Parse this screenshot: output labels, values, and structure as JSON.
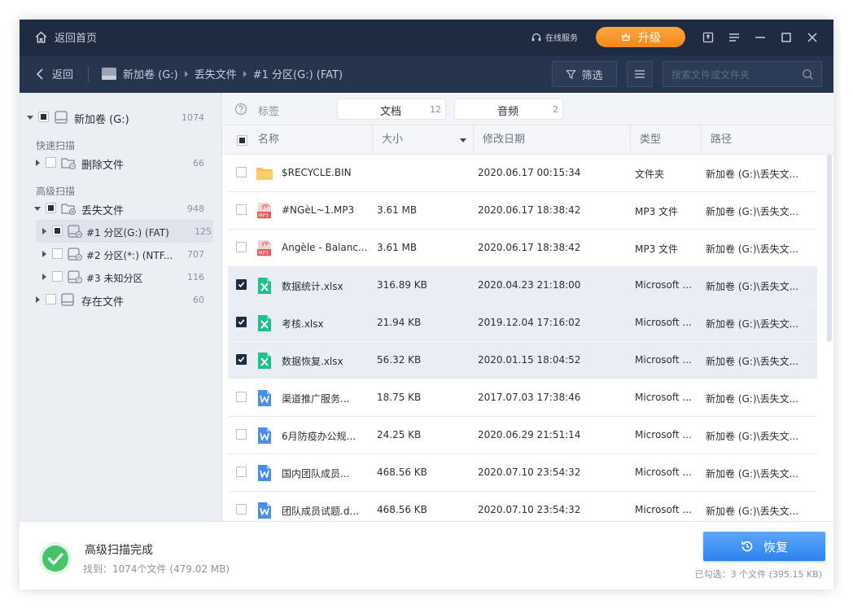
{
  "titlebar": {
    "home_label": "返回首页",
    "online_service": "在线服务",
    "upgrade_label": "升级"
  },
  "toolbar": {
    "back_label": "返回",
    "breadcrumb": [
      "新加卷 (G:)",
      "丢失文件",
      "#1 分区(G:) (FAT)"
    ],
    "filter_label": "筛选",
    "search_placeholder": "搜索文件或文件夹"
  },
  "sidebar": {
    "root": {
      "label": "新加卷 (G:)",
      "count": "1074"
    },
    "quick_scan_label": "快速扫描",
    "deleted": {
      "label": "删除文件",
      "count": "66"
    },
    "advanced_scan_label": "高级扫描",
    "lost": {
      "label": "丢失文件",
      "count": "948"
    },
    "partitions": [
      {
        "label": "#1 分区(G:) (FAT)",
        "count": "125"
      },
      {
        "label": "#2 分区(*:) (NTF...",
        "count": "707"
      },
      {
        "label": "#3 未知分区",
        "count": "116"
      }
    ],
    "existing": {
      "label": "存在文件",
      "count": "60"
    }
  },
  "tags": {
    "label": "标签",
    "items": [
      {
        "name": "文档",
        "count": "12"
      },
      {
        "name": "音频",
        "count": "2"
      }
    ]
  },
  "table": {
    "headers": {
      "name": "名称",
      "size": "大小",
      "date": "修改日期",
      "type": "类型",
      "path": "路径"
    },
    "rows": [
      {
        "icon": "folder-icon",
        "name": "$RECYCLE.BIN",
        "size": "",
        "date": "2020.06.17 00:15:34",
        "type": "文件夹",
        "path": "新加卷 (G:)\\丢失文...",
        "checked": false
      },
      {
        "icon": "mp3-file-icon",
        "name": "#NGèL~1.MP3",
        "size": "3.61 MB",
        "date": "2020.06.17 18:38:42",
        "type": "MP3 文件",
        "path": "新加卷 (G:)\\丢失文...",
        "checked": false
      },
      {
        "icon": "mp3-file-icon",
        "name": "Angèle - Balanc...",
        "size": "3.61 MB",
        "date": "2020.06.17 18:38:42",
        "type": "MP3 文件",
        "path": "新加卷 (G:)\\丢失文...",
        "checked": false
      },
      {
        "icon": "excel-file-icon",
        "name": "数据统计.xlsx",
        "size": "316.89 KB",
        "date": "2020.04.23 21:18:00",
        "type": "Microsoft ...",
        "path": "新加卷 (G:)\\丢失文...",
        "checked": true
      },
      {
        "icon": "excel-file-icon",
        "name": "考核.xlsx",
        "size": "21.94 KB",
        "date": "2019.12.04 17:16:02",
        "type": "Microsoft ...",
        "path": "新加卷 (G:)\\丢失文...",
        "checked": true
      },
      {
        "icon": "excel-file-icon",
        "name": "数据恢复.xlsx",
        "size": "56.32 KB",
        "date": "2020.01.15 18:04:52",
        "type": "Microsoft ...",
        "path": "新加卷 (G:)\\丢失文...",
        "checked": true
      },
      {
        "icon": "word-file-icon",
        "name": "渠道推广服务...",
        "size": "18.75 KB",
        "date": "2017.07.03 17:38:46",
        "type": "Microsoft ...",
        "path": "新加卷 (G:)\\丢失文...",
        "checked": false
      },
      {
        "icon": "word-file-icon",
        "name": "6月防疫办公规...",
        "size": "24.25 KB",
        "date": "2020.06.29 21:51:14",
        "type": "Microsoft ...",
        "path": "新加卷 (G:)\\丢失文...",
        "checked": false
      },
      {
        "icon": "word-file-icon",
        "name": "国内团队成员...",
        "size": "468.56 KB",
        "date": "2020.07.10 23:54:32",
        "type": "Microsoft ...",
        "path": "新加卷 (G:)\\丢失文...",
        "checked": false
      },
      {
        "icon": "word-file-icon",
        "name": "团队成员试题.d...",
        "size": "468.56 KB",
        "date": "2020.07.10 23:54:32",
        "type": "Microsoft ...",
        "path": "新加卷 (G:)\\丢失文...",
        "checked": false
      }
    ]
  },
  "footer": {
    "status_title": "高级扫描完成",
    "status_detail": "找到：1074个文件 (479.02 MB)",
    "recover_label": "恢复",
    "selected_info": "已勾选：3 个文件 (395.15 KB)"
  },
  "colors": {
    "titlebar_bg": "#1f2b40",
    "toolbar_bg": "#26344d",
    "upgrade_orange": "#f5921e",
    "recover_blue": "#3b8ff2",
    "success_green": "#46c46a",
    "excel_green": "#1fc18a",
    "word_blue": "#4a8fe7",
    "mp3_red": "#e8575a",
    "folder_yellow": "#f7c052"
  }
}
